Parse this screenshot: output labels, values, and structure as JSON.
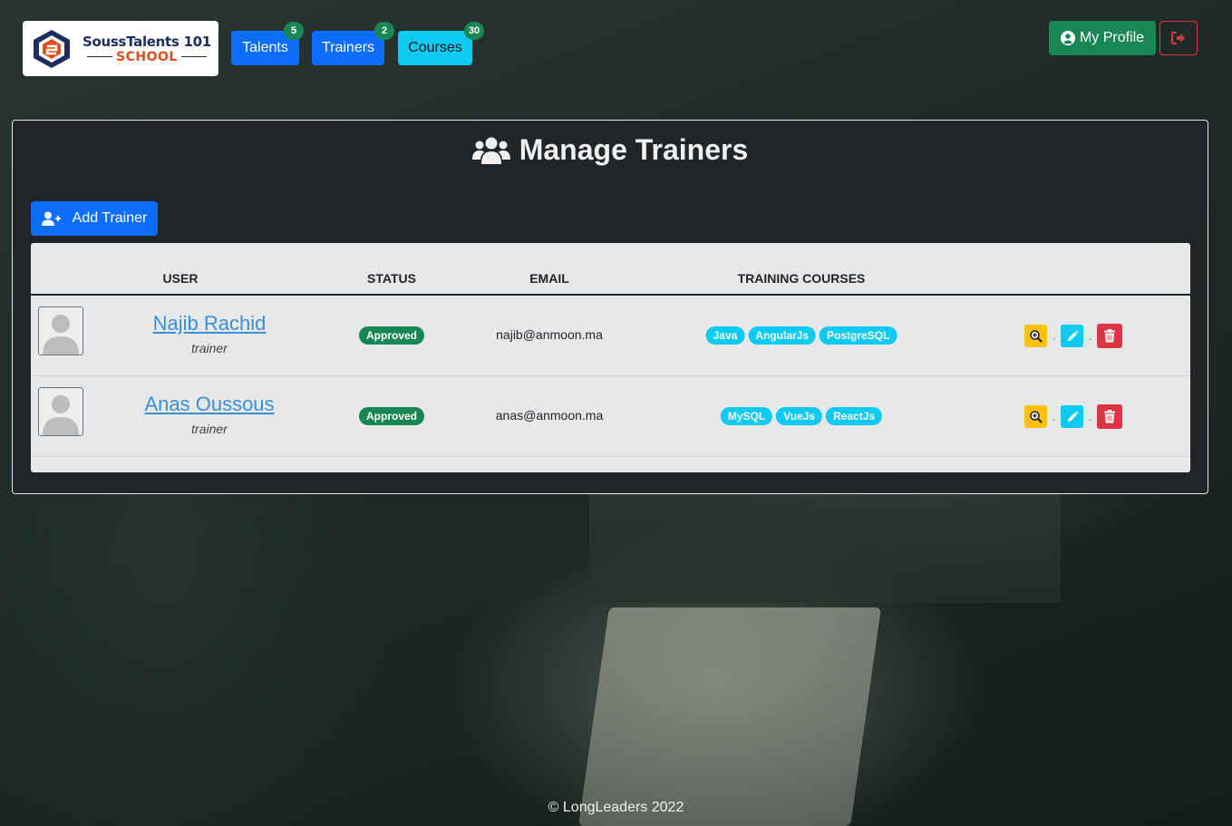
{
  "brand": {
    "logo_line1": "SoussTalents 101",
    "logo_line2": "SCHOOL"
  },
  "nav": [
    {
      "label": "Talents",
      "count": "5"
    },
    {
      "label": "Trainers",
      "count": "2"
    },
    {
      "label": "Courses",
      "count": "30"
    }
  ],
  "header": {
    "profile_label": "My Profile"
  },
  "page": {
    "title": "Manage Trainers",
    "add_button": "Add Trainer"
  },
  "table": {
    "headers": {
      "user": "USER",
      "status": "STATUS",
      "email": "EMAIL",
      "courses": "TRAINING COURSES"
    },
    "rows": [
      {
        "name": "Najib Rachid",
        "role": "trainer",
        "status": "Approved",
        "email": "najib@anmoon.ma",
        "courses": [
          "Java",
          "AngularJs",
          "PostgreSQL"
        ]
      },
      {
        "name": "Anas Oussous",
        "role": "trainer",
        "status": "Approved",
        "email": "anas@anmoon.ma",
        "courses": [
          "MySQL",
          "VueJs",
          "ReactJs"
        ]
      }
    ],
    "action_separator": "-"
  },
  "footer": {
    "text": "© LongLeaders 2022"
  },
  "colors": {
    "primary": "#0d6efd",
    "success": "#198754",
    "info": "#0dcaf0",
    "warning": "#ffc107",
    "danger": "#dc3545"
  },
  "icons": {
    "profile": "user-circle-icon",
    "logout": "sign-out-icon",
    "title": "users-icon",
    "add": "user-plus-icon",
    "view": "search-plus-icon",
    "edit": "pencil-icon",
    "delete": "trash-icon"
  }
}
